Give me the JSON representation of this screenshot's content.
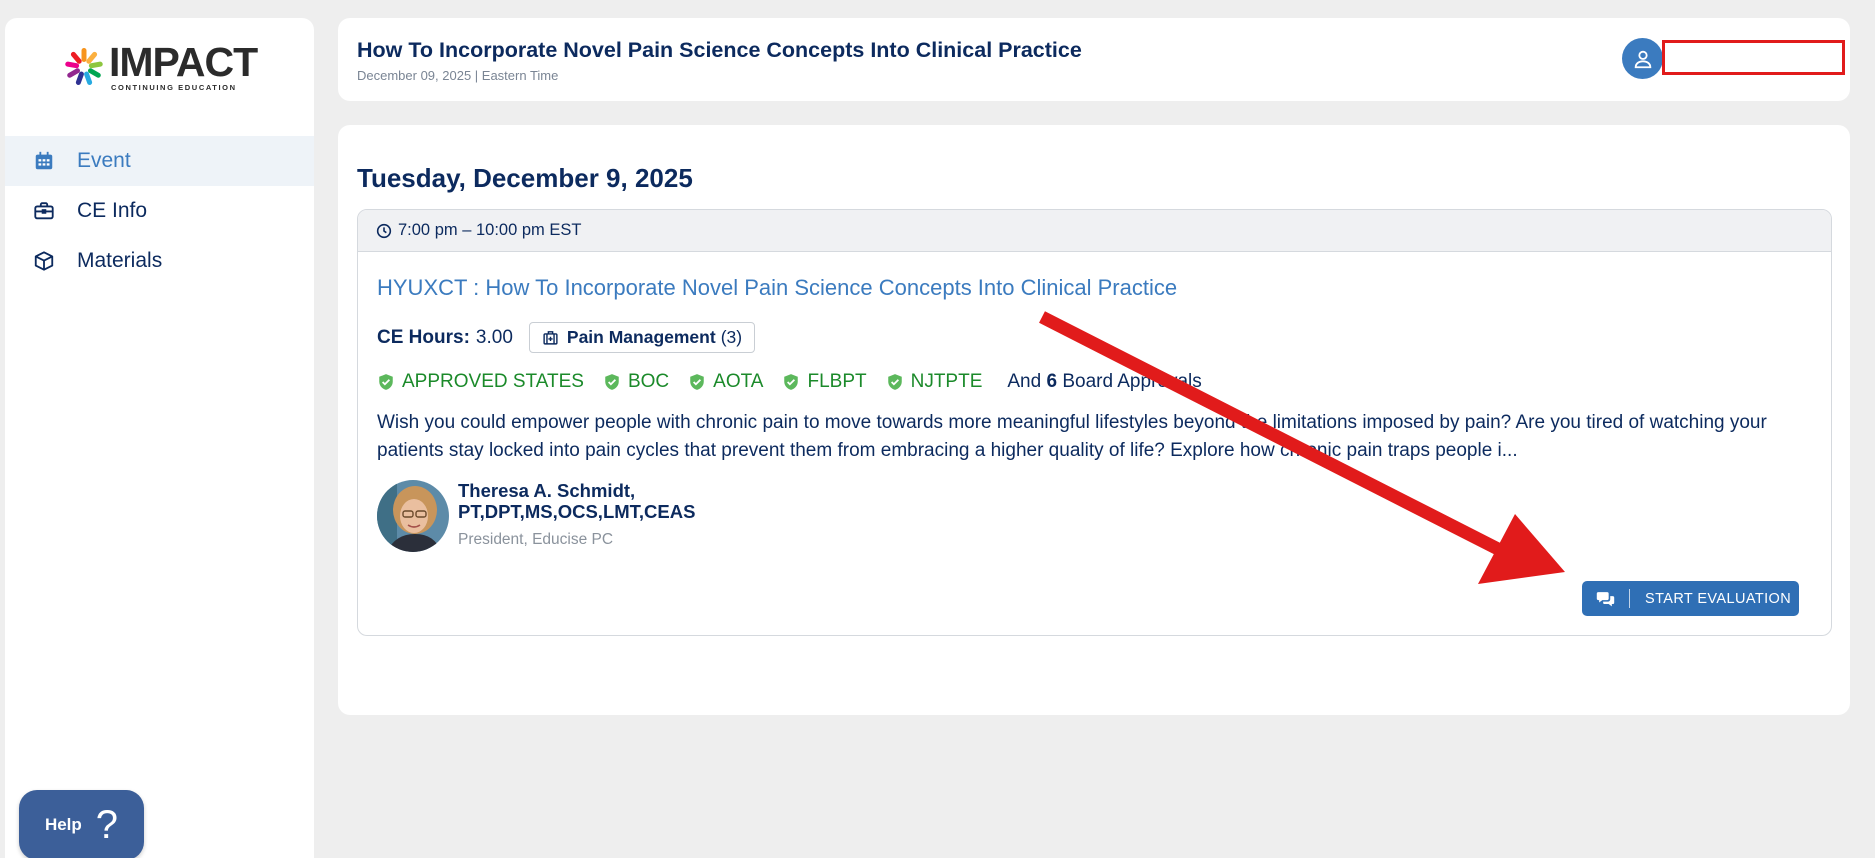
{
  "brand": {
    "name": "IMPACT",
    "tagline": "CONTINUING EDUCATION"
  },
  "sidebar": {
    "items": [
      {
        "label": "Event",
        "icon": "calendar-icon",
        "active": true
      },
      {
        "label": "CE Info",
        "icon": "briefcase-icon",
        "active": false
      },
      {
        "label": "Materials",
        "icon": "box-icon",
        "active": false
      }
    ],
    "help_label": "Help",
    "help_glyph": "?"
  },
  "header": {
    "title": "How To Incorporate Novel Pain Science Concepts Into Clinical Practice",
    "subtitle": "December 09, 2025 | Eastern Time",
    "user_name": ""
  },
  "main": {
    "day_heading": "Tuesday, December 9, 2025",
    "event": {
      "time": "7:00 pm – 10:00 pm EST",
      "link_text": "HYUXCT : How To Incorporate Novel Pain Science Concepts Into Clinical Practice",
      "ce_label": "CE Hours:",
      "ce_value": "3.00",
      "topic_name": "Pain Management",
      "topic_count": "(3)",
      "approvals": [
        "APPROVED STATES",
        "BOC",
        "AOTA",
        "FLBPT",
        "NJTPTE"
      ],
      "approvals_more_prefix": "And",
      "approvals_more_count": "6",
      "approvals_more_suffix": "Board Approvals",
      "description": "Wish you could empower people with chronic pain to move towards more meaningful lifestyles beyond the limitations imposed by pain? Are you tired of watching your patients stay locked into pain cycles that prevent them from embracing a higher quality of life? Explore how chronic pain traps people i...",
      "speaker_name": "Theresa A. Schmidt, PT,DPT,MS,OCS,LMT,CEAS",
      "speaker_role": "President, Educise PC",
      "eval_button": "START EVALUATION"
    }
  },
  "colors": {
    "primary": "#3b7bbf",
    "navy": "#0c2a5e",
    "approved_green": "#1b8a2a",
    "annotation_red": "#e11b1b"
  }
}
